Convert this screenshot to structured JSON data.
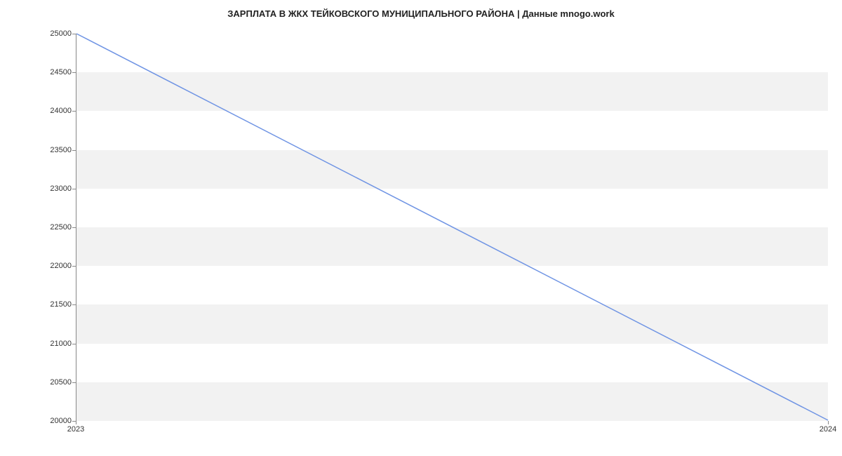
{
  "chart_data": {
    "type": "line",
    "title": "ЗАРПЛАТА В ЖКХ ТЕЙКОВСКОГО МУНИЦИПАЛЬНОГО РАЙОНА | Данные mnogo.work",
    "xlabel": "",
    "ylabel": "",
    "x_ticks": [
      "2023",
      "2024"
    ],
    "y_ticks": [
      20000,
      20500,
      21000,
      21500,
      22000,
      22500,
      23000,
      23500,
      24000,
      24500,
      25000
    ],
    "ylim": [
      20000,
      25000
    ],
    "x": [
      "2023",
      "2024"
    ],
    "values": [
      25000,
      20000
    ],
    "line_color": "#6f94e4",
    "grid": {
      "bands": true
    }
  }
}
